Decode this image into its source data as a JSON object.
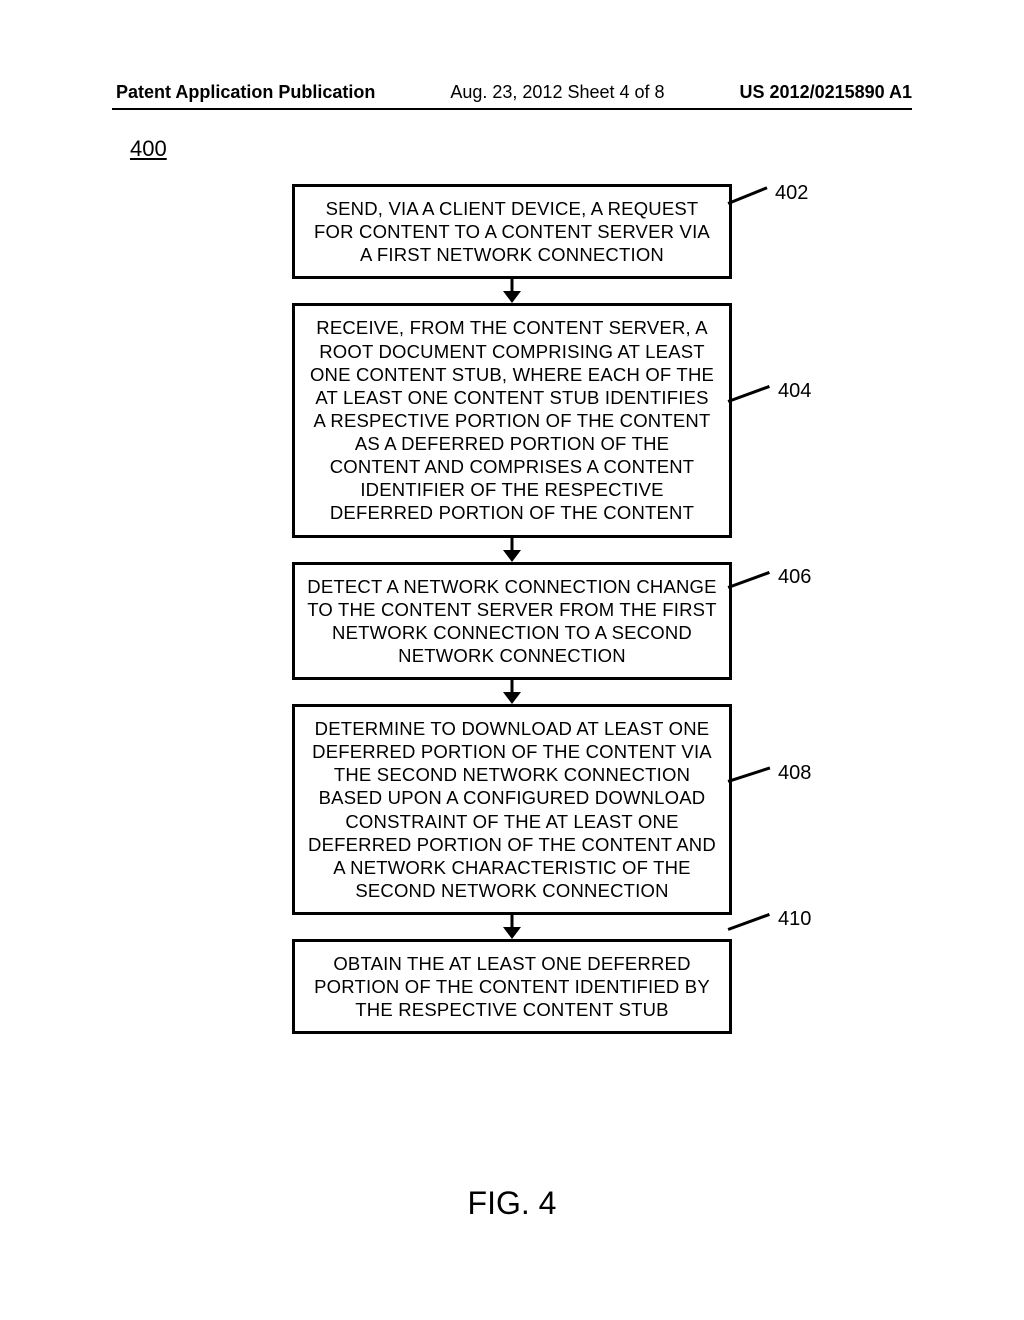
{
  "header": {
    "left": "Patent Application Publication",
    "mid": "Aug. 23, 2012  Sheet 4 of 8",
    "right": "US 2012/0215890 A1"
  },
  "figure_number": "400",
  "boxes": {
    "b402": {
      "ref": "402",
      "text": "SEND, VIA A CLIENT DEVICE, A REQUEST FOR CONTENT TO A CONTENT SERVER VIA A FIRST NETWORK CONNECTION"
    },
    "b404": {
      "ref": "404",
      "text": "RECEIVE, FROM THE CONTENT SERVER, A ROOT DOCUMENT COMPRISING AT LEAST ONE CONTENT STUB, WHERE EACH OF THE AT LEAST ONE CONTENT STUB IDENTIFIES A RESPECTIVE PORTION OF THE CONTENT AS A DEFERRED PORTION OF THE CONTENT AND COMPRISES A CONTENT IDENTIFIER OF THE RESPECTIVE DEFERRED PORTION OF THE CONTENT"
    },
    "b406": {
      "ref": "406",
      "text": "DETECT A NETWORK CONNECTION CHANGE TO THE CONTENT SERVER FROM THE FIRST NETWORK CONNECTION TO A SECOND NETWORK CONNECTION"
    },
    "b408": {
      "ref": "408",
      "text": "DETERMINE TO DOWNLOAD AT LEAST ONE DEFERRED PORTION OF THE CONTENT VIA THE SECOND NETWORK CONNECTION BASED UPON A CONFIGURED DOWNLOAD CONSTRAINT OF THE AT LEAST ONE DEFERRED PORTION OF THE CONTENT AND A NETWORK CHARACTERISTIC OF THE SECOND NETWORK CONNECTION"
    },
    "b410": {
      "ref": "410",
      "text": "OBTAIN THE AT LEAST ONE DEFERRED PORTION OF THE CONTENT IDENTIFIED BY THE RESPECTIVE CONTENT STUB"
    }
  },
  "caption": "FIG. 4"
}
